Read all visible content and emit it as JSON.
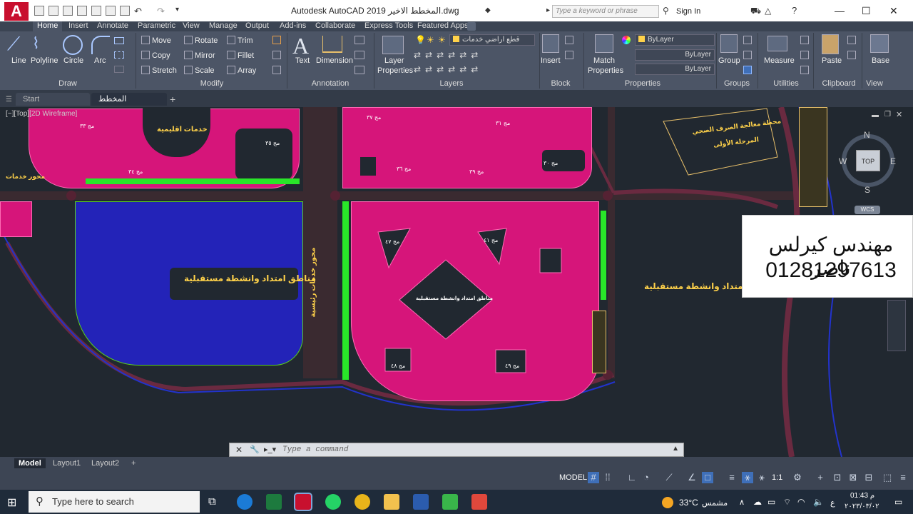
{
  "titlebar": {
    "app_logo": "A",
    "title": "Autodesk AutoCAD 2019   المخطط الاخير.dwg",
    "search_placeholder": "Type a keyword or phrase",
    "sign_in": "Sign In",
    "minimize": "—",
    "maximize": "☐",
    "close": "✕"
  },
  "ribbon_tabs": [
    "Home",
    "Insert",
    "Annotate",
    "Parametric",
    "View",
    "Manage",
    "Output",
    "Add-ins",
    "Collaborate",
    "Express Tools",
    "Featured Apps"
  ],
  "draw": {
    "title": "Draw",
    "line": "Line",
    "polyline": "Polyline",
    "circle": "Circle",
    "arc": "Arc"
  },
  "modify": {
    "title": "Modify",
    "move": "Move",
    "rotate": "Rotate",
    "trim": "Trim",
    "copy": "Copy",
    "mirror": "Mirror",
    "fillet": "Fillet",
    "stretch": "Stretch",
    "scale": "Scale",
    "array": "Array"
  },
  "annotation": {
    "title": "Annotation",
    "text": "Text",
    "dimension": "Dimension"
  },
  "layers": {
    "title": "Layers",
    "layer_properties": "Layer",
    "layer_properties2": "Properties",
    "current_layer": "قطع اراضي خدمات"
  },
  "block": {
    "title": "Block",
    "insert": "Insert"
  },
  "properties": {
    "title": "Properties",
    "match": "Match",
    "match2": "Properties",
    "color": "ByLayer",
    "linetype": "ByLayer",
    "lineweight": "ByLayer"
  },
  "groups": {
    "title": "Groups",
    "group": "Group"
  },
  "utilities": {
    "title": "Utilities",
    "measure": "Measure"
  },
  "clipboard": {
    "title": "Clipboard",
    "paste": "Paste"
  },
  "view_panel": {
    "title": "View",
    "base": "Base"
  },
  "doc_tabs": {
    "start": "Start",
    "drawing": "المخطط الاخير*",
    "add": "+"
  },
  "canvas": {
    "viewport_label": "[−][Top][2D Wireframe]",
    "labels": {
      "services_left": "خدمات اقليمية",
      "services_axis": "محور خدمات",
      "future_ext": "مناطق امتداد وانشطة مستقبلية",
      "future_ext_right": "مناطق امتداد وانشطة مستقبلية",
      "axis_vertical": "محور خدمات رئيسية",
      "center_zone": "مناطق امتداد وانشطة مستقبلية",
      "plant": "محطة معالجة الصرف الصحي",
      "plant_phase": "المرحلة الأولى",
      "m33": "مج ٣٣",
      "m34": "مج ٣٤",
      "m35": "مج ٣٥",
      "m36": "مج ٣٦",
      "m37": "مج ٣٧",
      "m39": "مج ٣٩",
      "m30": "مج ٣٠",
      "m31": "مج ٣١",
      "m47": "مج ٤٧",
      "m41": "مج ٤١",
      "m48": "مج ٤٨",
      "m49": "مج ٤٩"
    }
  },
  "viewcube": {
    "north": "N",
    "south": "S",
    "east": "E",
    "west": "W",
    "face": "TOP",
    "wcs": "WCS"
  },
  "watermark": {
    "name": "مهندس كيرلس ناصر",
    "phone": "01281297613"
  },
  "command": {
    "placeholder": "Type a command"
  },
  "layout_tabs": [
    "Model",
    "Layout1",
    "Layout2"
  ],
  "status": {
    "model": "MODEL",
    "scale": "1:1"
  },
  "taskbar": {
    "search": "Type here to search",
    "temp": "33°C",
    "weather": "مشمس",
    "time": "01:43 م",
    "date": "٢٠٢٣/٠٣/٠٢",
    "lang": "ع"
  },
  "colors": {
    "accent": "#c8102e",
    "plot_magenta": "#d6157a",
    "plot_blue": "#2323b8",
    "green_space": "#29e629",
    "label_yellow": "#ffd24a"
  }
}
